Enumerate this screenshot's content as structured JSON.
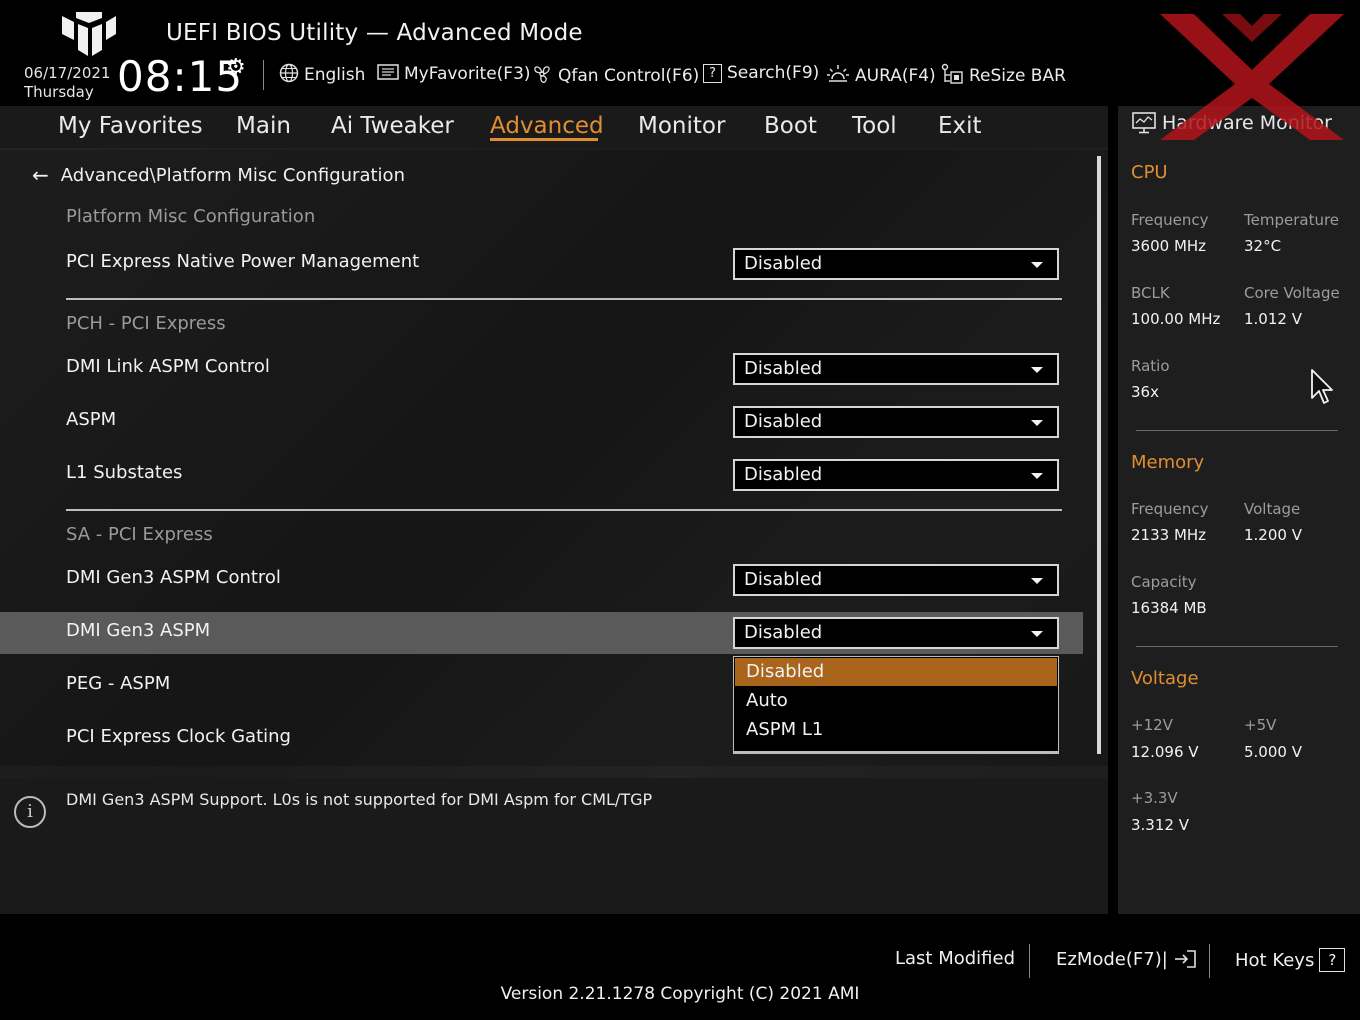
{
  "header": {
    "title": "UEFI BIOS Utility — Advanced Mode",
    "date": "06/17/2021",
    "weekday": "Thursday",
    "time": "08:15",
    "tools": [
      {
        "label": "English",
        "icon": "globe-icon"
      },
      {
        "label": "MyFavorite(F3)",
        "icon": "favorite-list-icon"
      },
      {
        "label": "Qfan Control(F6)",
        "icon": "fan-icon"
      },
      {
        "label": "Search(F9)",
        "icon": "search-help-icon"
      },
      {
        "label": "AURA(F4)",
        "icon": "aura-light-icon"
      },
      {
        "label": "ReSize BAR",
        "icon": "resize-bar-icon"
      }
    ]
  },
  "nav": {
    "tabs": [
      "My Favorites",
      "Main",
      "Ai Tweaker",
      "Advanced",
      "Monitor",
      "Boot",
      "Tool",
      "Exit"
    ],
    "active": "Advanced"
  },
  "breadcrumb": "Advanced\\Platform Misc Configuration",
  "sections": {
    "platform": "Platform Misc Configuration",
    "pch": "PCH - PCI Express",
    "sa": "SA - PCI Express"
  },
  "settings": [
    {
      "label": "PCI Express Native Power Management",
      "value": "Disabled"
    },
    {
      "label": "DMI Link ASPM Control",
      "value": "Disabled"
    },
    {
      "label": "ASPM",
      "value": "Disabled"
    },
    {
      "label": "L1 Substates",
      "value": "Disabled"
    },
    {
      "label": "DMI Gen3 ASPM Control",
      "value": "Disabled"
    },
    {
      "label": "DMI Gen3 ASPM",
      "value": "Disabled"
    },
    {
      "label": "PEG - ASPM",
      "value": ""
    },
    {
      "label": "PCI Express Clock Gating",
      "value": ""
    }
  ],
  "dropdown_options": [
    "Disabled",
    "Auto",
    "ASPM L1"
  ],
  "dropdown_selected": "Disabled",
  "help_text": "DMI Gen3 ASPM Support.  L0s is not supported for DMI Aspm for CML/TGP",
  "hardware_monitor": {
    "title": "Hardware Monitor",
    "cpu": {
      "heading": "CPU",
      "frequency_label": "Frequency",
      "frequency": "3600 MHz",
      "temperature_label": "Temperature",
      "temperature": "32°C",
      "bclk_label": "BCLK",
      "bclk": "100.00 MHz",
      "core_voltage_label": "Core Voltage",
      "core_voltage": "1.012 V",
      "ratio_label": "Ratio",
      "ratio": "36x"
    },
    "memory": {
      "heading": "Memory",
      "frequency_label": "Frequency",
      "frequency": "2133 MHz",
      "voltage_label": "Voltage",
      "voltage": "1.200 V",
      "capacity_label": "Capacity",
      "capacity": "16384 MB"
    },
    "voltage": {
      "heading": "Voltage",
      "v12_label": "+12V",
      "v12": "12.096 V",
      "v5_label": "+5V",
      "v5": "5.000 V",
      "v33_label": "+3.3V",
      "v33": "3.312 V"
    }
  },
  "footer": {
    "last_modified": "Last Modified",
    "ezmode": "EzMode(F7)|",
    "hotkeys": "Hot Keys",
    "version": "Version 2.21.1278 Copyright (C) 2021 AMI"
  },
  "colors": {
    "accent": "#e08e32",
    "selected_option": "#a9651b",
    "highlight_row": "#5a5a5a"
  }
}
